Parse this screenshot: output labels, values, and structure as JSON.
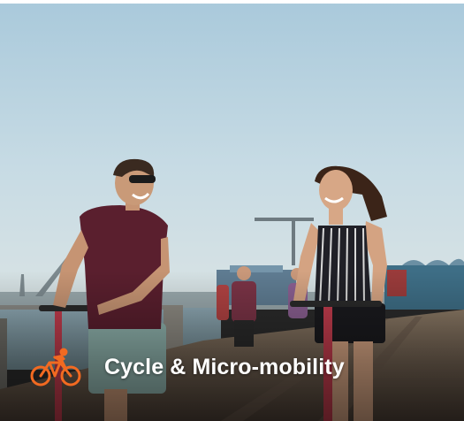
{
  "card": {
    "title": "Cycle & Micro-mobility",
    "icon": "cyclist-icon"
  },
  "colors": {
    "accent": "#f26a21",
    "label": "#ffffff"
  }
}
